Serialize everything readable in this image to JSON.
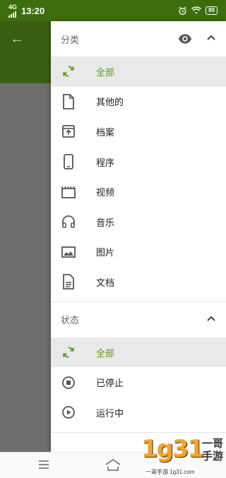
{
  "status_bar": {
    "network": "4G",
    "time": "13:20",
    "battery": "89"
  },
  "drawer": {
    "category": {
      "title": "分类",
      "items": [
        {
          "label": "全部",
          "icon": "refresh-icon",
          "selected": true
        },
        {
          "label": "其他的",
          "icon": "file-icon"
        },
        {
          "label": "档案",
          "icon": "archive-icon"
        },
        {
          "label": "程序",
          "icon": "phone-icon"
        },
        {
          "label": "视频",
          "icon": "video-icon"
        },
        {
          "label": "音乐",
          "icon": "headphones-icon"
        },
        {
          "label": "图片",
          "icon": "image-icon"
        },
        {
          "label": "文档",
          "icon": "document-icon"
        }
      ]
    },
    "status": {
      "title": "状态",
      "items": [
        {
          "label": "全部",
          "icon": "refresh-icon",
          "selected": true
        },
        {
          "label": "已停止",
          "icon": "stop-circle-icon"
        },
        {
          "label": "运行中",
          "icon": "play-circle-icon"
        }
      ]
    }
  },
  "watermark": {
    "left": "1g31",
    "right_top": "一哥",
    "right_bottom": "手游",
    "strip": "一哥手游 1g31.com"
  },
  "colors": {
    "accent": "#5c9a1b",
    "status_bar": "#3e6d0e",
    "app_bar": "#3a5f12",
    "selected_bg": "#e9e9e9"
  }
}
